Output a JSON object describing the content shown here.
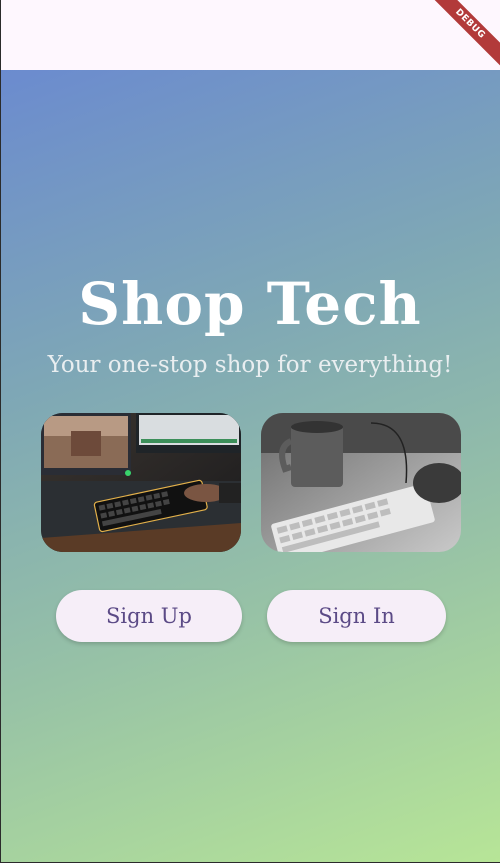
{
  "debug_banner": "DEBUG",
  "hero": {
    "title": "Shop Tech",
    "subtitle": "Your one-stop shop for everything!"
  },
  "images": [
    {
      "name": "gaming keyboard photo"
    },
    {
      "name": "keyboard and mug photo"
    }
  ],
  "actions": {
    "sign_up_label": "Sign Up",
    "sign_in_label": "Sign In"
  },
  "colors": {
    "gradient_start": "#6b8bcf",
    "gradient_end": "#b7e597",
    "button_bg": "#f6eef8",
    "button_text": "#5b4a86",
    "debug_ribbon": "#b23a3a"
  }
}
